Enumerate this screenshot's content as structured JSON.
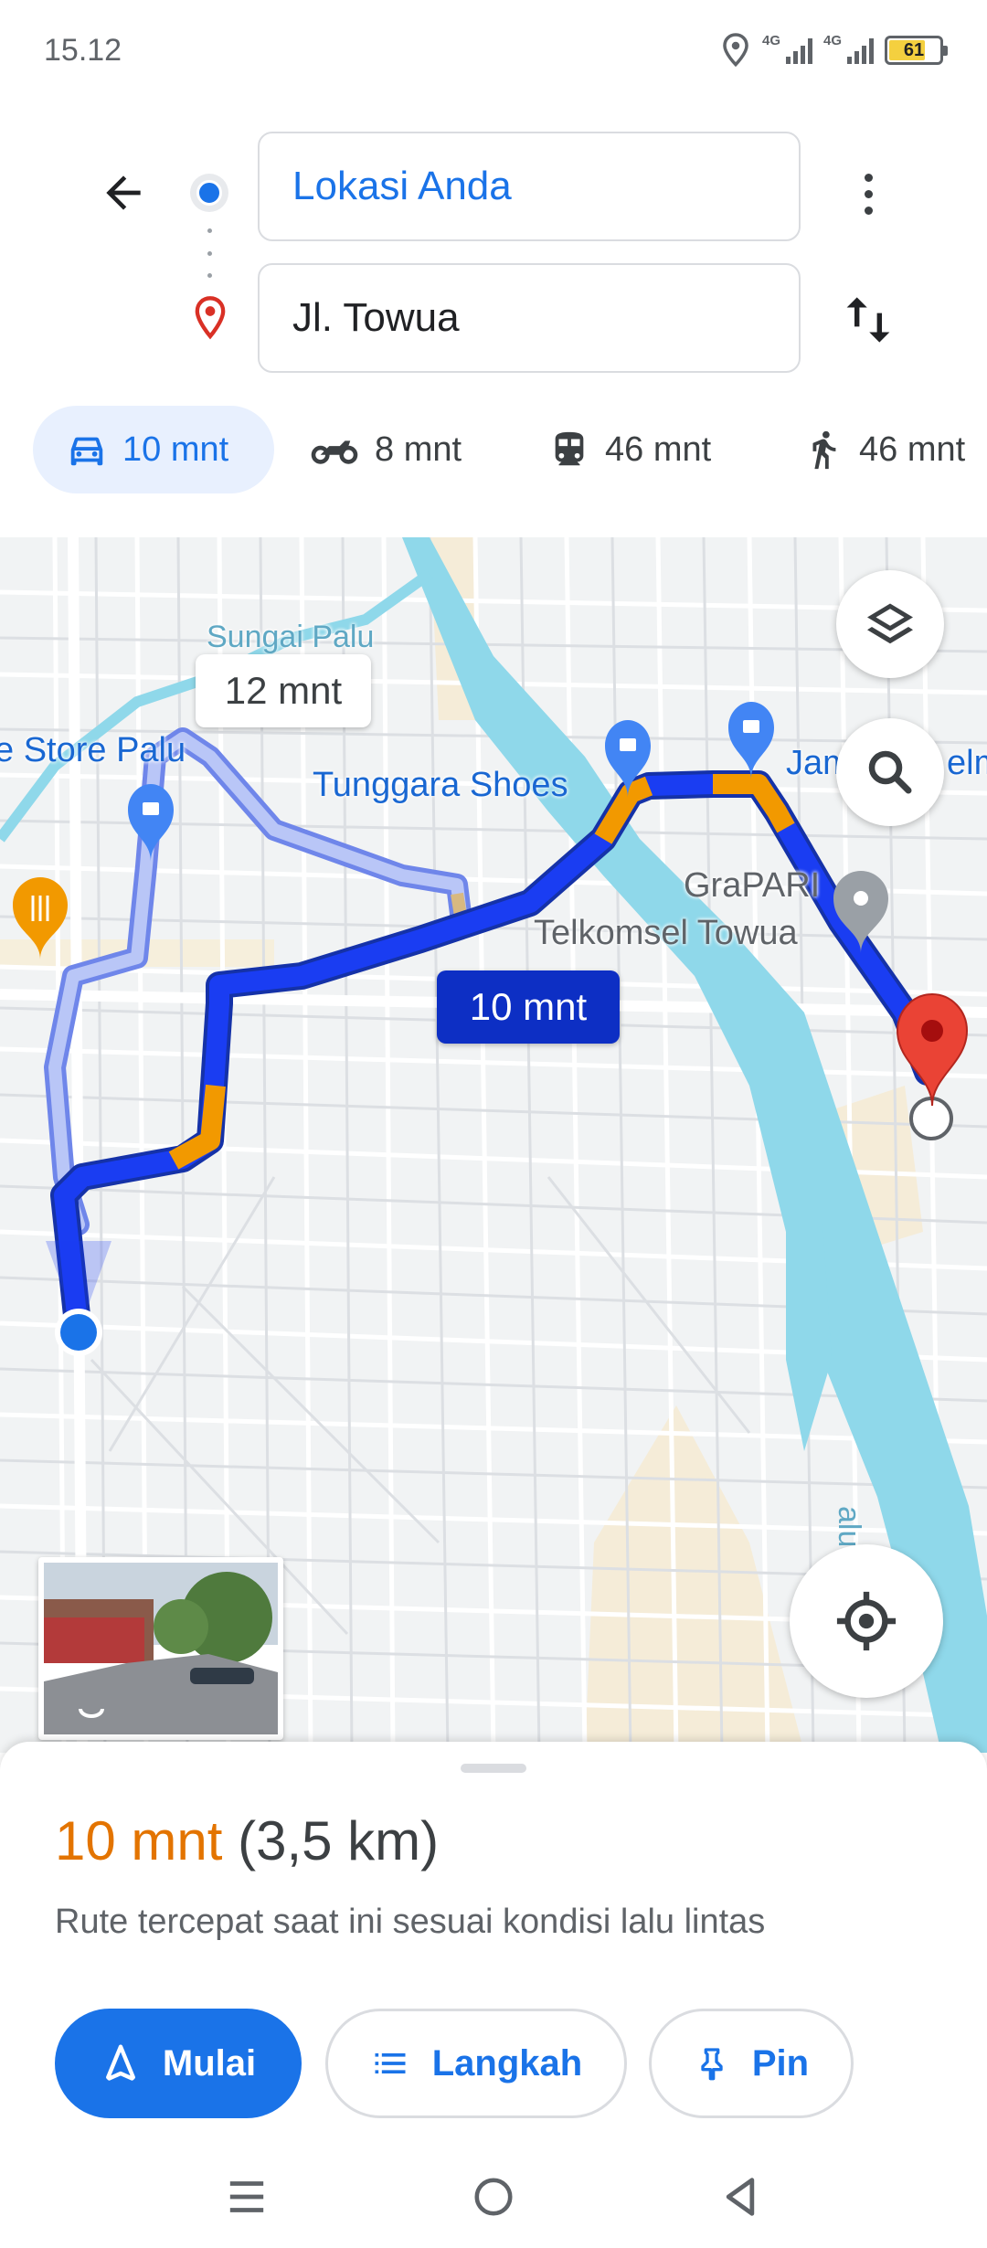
{
  "status_bar": {
    "time": "15.12",
    "network_1": "4G",
    "network_2": "4G",
    "battery_level": "61",
    "icons": [
      "location-icon",
      "signal-icon",
      "signal-icon",
      "battery-icon"
    ]
  },
  "directions": {
    "origin": "Lokasi Anda",
    "destination": "Jl. Towua",
    "icons": {
      "back": "arrow-left-icon",
      "more": "more-vert-icon",
      "swap": "swap-vert-icon"
    }
  },
  "modes": [
    {
      "id": "car",
      "label": "10 mnt",
      "icon": "car-icon",
      "selected": true
    },
    {
      "id": "motorcycle",
      "label": "8 mnt",
      "icon": "motorcycle-icon"
    },
    {
      "id": "transit",
      "label": "46 mnt",
      "icon": "train-icon"
    },
    {
      "id": "walk",
      "label": "46 mnt",
      "icon": "walk-icon"
    }
  ],
  "map": {
    "labels": {
      "river": "Sungai Palu",
      "store": "e Store Palu",
      "shoes": "Tunggara Shoes",
      "jam": "Jam",
      "elm": "elm",
      "grapari_1": "GraPARI",
      "grapari_2": "Telkomsel Towua",
      "river_vertical": "alu"
    },
    "alt_route_time": "12 mnt",
    "main_route_time": "10 mnt",
    "colors": {
      "route": "#1a3df2",
      "alt_route": "#aab8f5",
      "traffic": "#f29900",
      "water": "#8fd8ea",
      "destination_pin": "#ea4335"
    }
  },
  "sheet": {
    "eta": "10 mnt",
    "distance": "(3,5 km)",
    "description": "Rute tercepat saat ini sesuai kondisi lalu lintas",
    "start_label": "Mulai",
    "steps_label": "Langkah",
    "pin_label": "Pin"
  }
}
